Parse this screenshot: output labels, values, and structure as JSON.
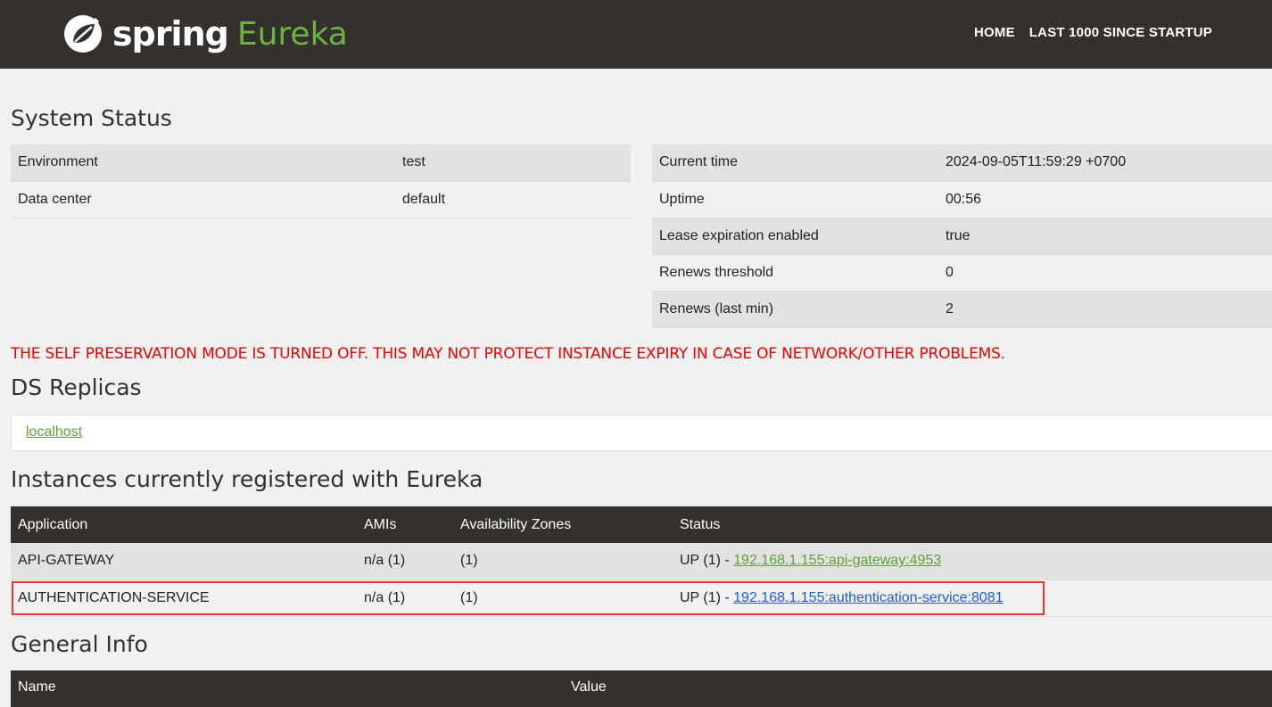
{
  "navbar": {
    "brand_spring": "spring",
    "brand_eureka": "Eureka",
    "links": [
      "HOME",
      "LAST 1000 SINCE STARTUP"
    ],
    "bg_color": "#34302d",
    "accent_color": "#6db33f"
  },
  "system_status": {
    "title": "System Status",
    "left": [
      {
        "label": "Environment",
        "value": "test"
      },
      {
        "label": "Data center",
        "value": "default"
      }
    ],
    "right": [
      {
        "label": "Current time",
        "value": "2024-09-05T11:59:29 +0700"
      },
      {
        "label": "Uptime",
        "value": "00:56"
      },
      {
        "label": "Lease expiration enabled",
        "value": "true"
      },
      {
        "label": "Renews threshold",
        "value": "0"
      },
      {
        "label": "Renews (last min)",
        "value": "2"
      }
    ]
  },
  "warning": "THE SELF PRESERVATION MODE IS TURNED OFF. THIS MAY NOT PROTECT INSTANCE EXPIRY IN CASE OF NETWORK/OTHER PROBLEMS.",
  "ds_replicas": {
    "title": "DS Replicas",
    "items": [
      "localhost"
    ]
  },
  "instances": {
    "title": "Instances currently registered with Eureka",
    "columns": [
      "Application",
      "AMIs",
      "Availability Zones",
      "Status"
    ],
    "rows": [
      {
        "application": "API-GATEWAY",
        "amis": "n/a (1)",
        "zones": "(1)",
        "status_prefix": "UP (1) - ",
        "status_link": "192.168.1.155:api-gateway:4953"
      },
      {
        "application": "AUTHENTICATION-SERVICE",
        "amis": "n/a (1)",
        "zones": "(1)",
        "status_prefix": "UP (1) - ",
        "status_link": "192.168.1.155:authentication-service:8081"
      }
    ]
  },
  "general_info": {
    "title": "General Info",
    "columns": [
      "Name",
      "Value"
    ]
  }
}
